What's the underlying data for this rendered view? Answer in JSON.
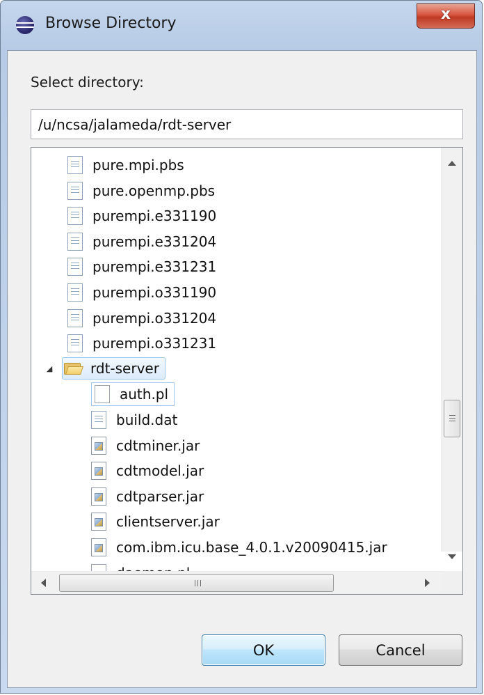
{
  "window": {
    "title": "Browse Directory",
    "close_label": "x"
  },
  "form": {
    "select_label": "Select directory:",
    "path_value": "/u/ncsa/jalameda/rdt-server"
  },
  "tree": {
    "top_files": [
      "pure.mpi.pbs",
      "pure.openmp.pbs",
      "purempi.e331190",
      "purempi.e331204",
      "purempi.e331231",
      "purempi.o331190",
      "purempi.o331204",
      "purempi.o331231"
    ],
    "folder": {
      "name": "rdt-server",
      "state": "expanded",
      "children": [
        {
          "name": "auth.pl",
          "icon": "blank-file-icon"
        },
        {
          "name": "build.dat",
          "icon": "text-file-icon"
        },
        {
          "name": "cdtminer.jar",
          "icon": "jar-file-icon"
        },
        {
          "name": "cdtmodel.jar",
          "icon": "jar-file-icon"
        },
        {
          "name": "cdtparser.jar",
          "icon": "jar-file-icon"
        },
        {
          "name": "clientserver.jar",
          "icon": "jar-file-icon"
        },
        {
          "name": "com.ibm.icu.base_4.0.1.v20090415.jar",
          "icon": "jar-file-icon"
        },
        {
          "name": "daemon.pl",
          "icon": "blank-file-icon"
        }
      ]
    },
    "hscroll_grip": "III"
  },
  "buttons": {
    "ok": "OK",
    "cancel": "Cancel"
  }
}
